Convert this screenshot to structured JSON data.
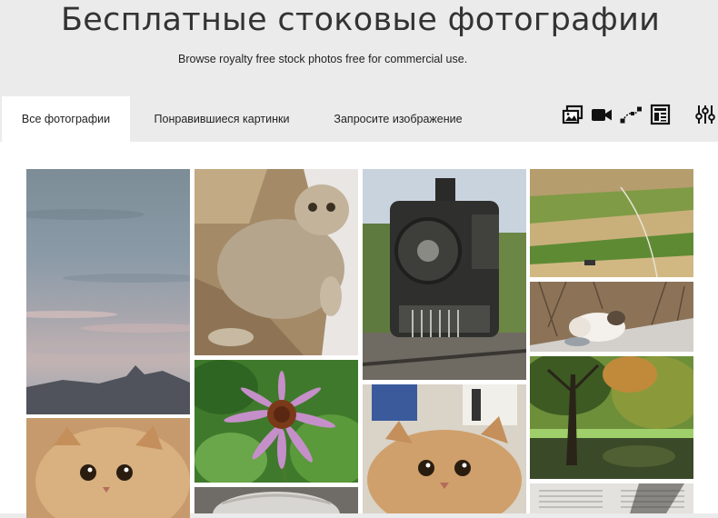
{
  "header": {
    "title": "Бесплатные стоковые фотографии",
    "subtitle": "Browse royalty free stock photos free for commercial use."
  },
  "tabs": [
    {
      "label": "Все фотографии",
      "active": true
    },
    {
      "label": "Понравившиеся картинки",
      "active": false
    },
    {
      "label": "Запросите изображение",
      "active": false
    }
  ],
  "toolbar": {
    "icons": [
      "photos-icon",
      "video-icon",
      "vector-icon",
      "layout-icon",
      "filters-icon"
    ]
  },
  "gallery": {
    "photos": [
      {
        "name": "sky-mountain-photo"
      },
      {
        "name": "cat-lying-photo"
      },
      {
        "name": "steam-locomotive-photo"
      },
      {
        "name": "fields-landscape-photo"
      },
      {
        "name": "cat-eating-photo"
      },
      {
        "name": "tree-pond-photo"
      },
      {
        "name": "cat-closeup-photo"
      },
      {
        "name": "coneflower-photo"
      },
      {
        "name": "cat-window-photo"
      },
      {
        "name": "knit-hat-photo"
      },
      {
        "name": "newspaper-photo"
      }
    ]
  },
  "colors": {
    "background": "#ebebeb",
    "content": "#ffffff",
    "text": "#222222"
  }
}
